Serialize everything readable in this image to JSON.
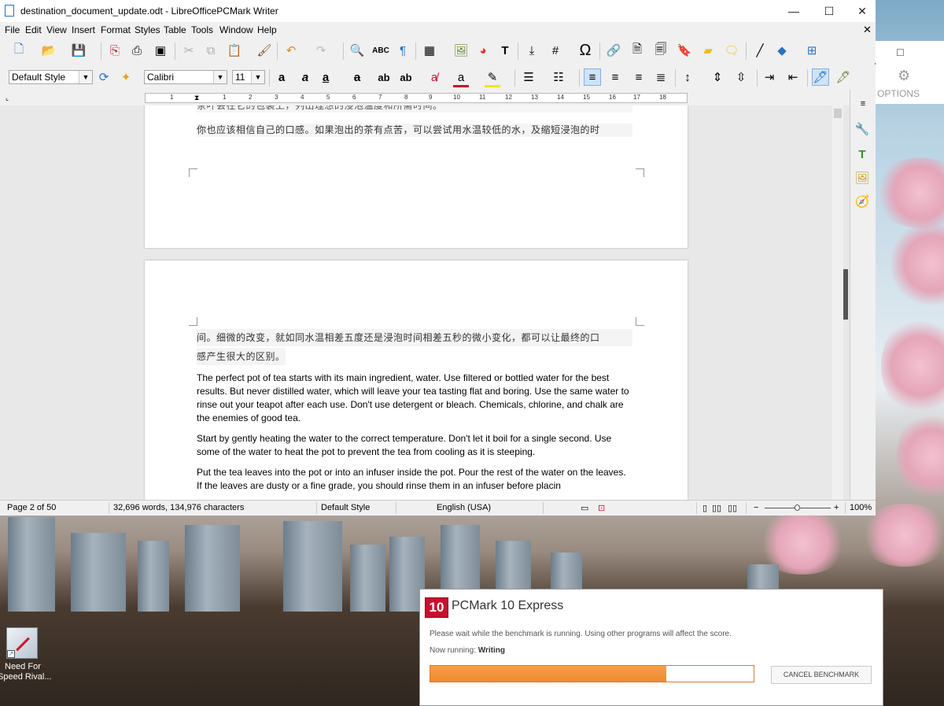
{
  "window": {
    "title": "destination_document_update.odt - LibreOfficePCMark Writer",
    "minimize": "—",
    "maximize": "☐",
    "close": "✕",
    "doc_close": "✕"
  },
  "menu": [
    "File",
    "Edit",
    "View",
    "Insert",
    "Format",
    "Styles",
    "Table",
    "Tools",
    "Window",
    "Help"
  ],
  "formatting": {
    "paragraph_style": "Default Style",
    "font_name": "Calibri",
    "font_size": "11"
  },
  "ruler": {
    "numbers": [
      "1",
      "1",
      "2",
      "3",
      "4",
      "5",
      "6",
      "7",
      "8",
      "9",
      "10",
      "11",
      "12",
      "13",
      "14",
      "15",
      "16",
      "17",
      "18"
    ]
  },
  "document": {
    "page1_cut_line": "茶叶会在它的包装上，列出理想的浸泡温度和所需时间。",
    "page1_line": "你也应该相信自己的口感。如果泡出的茶有点苦，可以尝试用水温较低的水，及缩短浸泡的时",
    "page2_cjk_line1": "间。细微的改变，就如同水温相差五度还是浸泡时间相差五秒的微小变化，都可以让最终的口",
    "page2_cjk_line2": "感产生很大的区别。",
    "para1": "The perfect pot of tea starts with its main ingredient, water. Use filtered or bottled water for the best results. But never distilled water, which will leave your tea tasting flat and boring. Use the same water to rinse out your teapot after each use. Don't use detergent or bleach. Chemicals, chlorine, and chalk are the enemies of good tea.",
    "para2": "Start by gently heating the water to the correct temperature. Don't let it boil for a single second. Use some of the water to heat the pot to prevent the tea from cooling as it is steeping.",
    "para3": "Put the tea leaves into the pot or into an infuser inside the pot. Pour the rest of the water on the leaves. If the leaves are dusty or a fine grade, you should rinse them in an infuser before placin"
  },
  "statusbar": {
    "page": "Page 2 of 50",
    "words": "32,696 words, 134,976 characters",
    "style": "Default Style",
    "language": "English (USA)",
    "zoom": "100%"
  },
  "backwindow": {
    "options_label": "OPTIONS",
    "settings_icon": "gear-icon"
  },
  "desktop_icon": {
    "label_line1": "Need For",
    "label_line2": "Speed Rival..."
  },
  "pcmark": {
    "logo": "10",
    "name": "PCMark 10 Express",
    "message": "Please wait while the benchmark is running. Using other programs will affect the score.",
    "running_prefix": "Now running:",
    "running_value": "Writing",
    "progress": 0.73,
    "cancel_label": "CANCEL BENCHMARK"
  },
  "colors": {
    "accent": "#2b72c4",
    "pcmark_red": "#c8102e",
    "progress_orange": "#ee8a2d"
  }
}
